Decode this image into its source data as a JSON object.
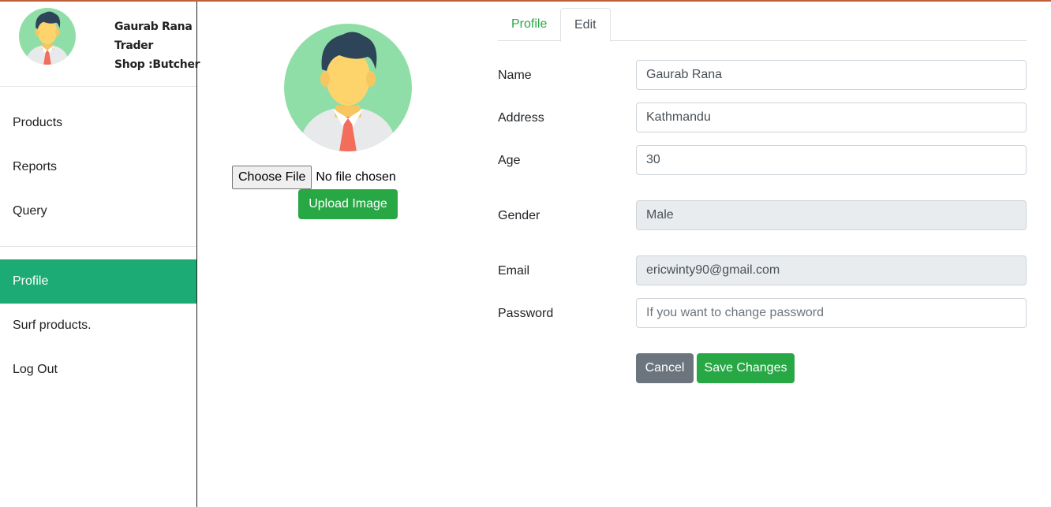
{
  "user": {
    "name": "Gaurab Rana",
    "role": "Trader",
    "shop": "Shop :Butcher"
  },
  "sidebar": {
    "items": [
      {
        "label": "Products"
      },
      {
        "label": "Reports"
      },
      {
        "label": "Query"
      },
      {
        "label": "Profile",
        "active": true
      },
      {
        "label": "Surf products."
      },
      {
        "label": "Log Out"
      }
    ]
  },
  "upload": {
    "choose_file_label": "Choose File",
    "file_status": "No file chosen",
    "upload_button": "Upload Image"
  },
  "tabs": {
    "profile": "Profile",
    "edit": "Edit",
    "active": "Edit"
  },
  "form": {
    "name": {
      "label": "Name",
      "value": "Gaurab Rana"
    },
    "address": {
      "label": "Address",
      "value": "Kathmandu"
    },
    "age": {
      "label": "Age",
      "value": "30"
    },
    "gender": {
      "label": "Gender",
      "value": "Male"
    },
    "email": {
      "label": "Email",
      "value": "ericwinty90@gmail.com"
    },
    "password": {
      "label": "Password",
      "placeholder": "If you want to change password"
    },
    "cancel_button": "Cancel",
    "save_button": "Save Changes"
  },
  "colors": {
    "accent_green": "#28a745",
    "active_nav": "#1dab75",
    "secondary": "#6c757d",
    "top_border": "#c0603a"
  },
  "icons": {
    "avatar": "user-avatar-icon"
  }
}
